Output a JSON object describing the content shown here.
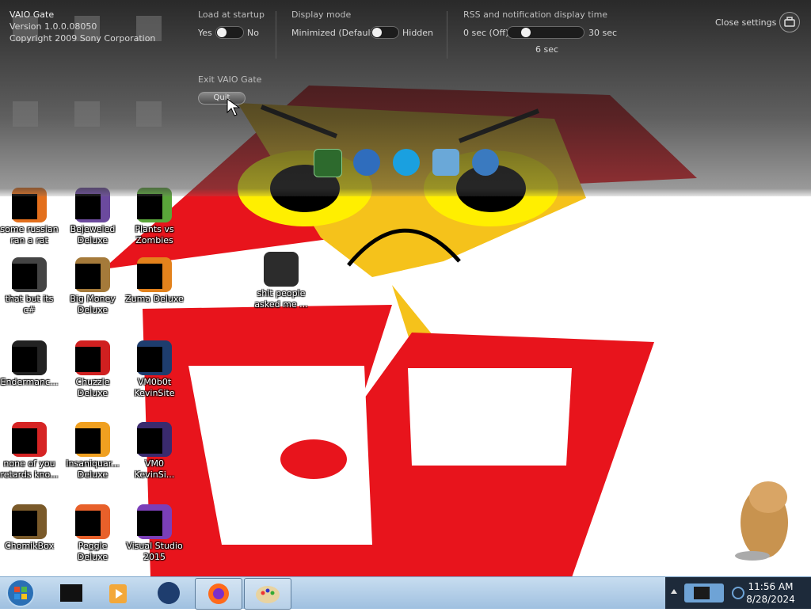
{
  "vaio": {
    "app_name": "VAIO Gate",
    "version": "Version 1.0.0.08050",
    "copyright": "Copyright 2009 Sony Corporation",
    "load_at_startup": {
      "header": "Load at startup",
      "yes": "Yes",
      "no": "No",
      "value": "Yes"
    },
    "display_mode": {
      "header": "Display mode",
      "left": "Minimized (Default)",
      "right": "Hidden",
      "value": "Minimized (Default)"
    },
    "rss_time": {
      "header": "RSS and notification display time",
      "min_label": "0 sec (Off)",
      "max_label": "30 sec",
      "value_label": "6 sec",
      "value": 6,
      "max": 30
    },
    "exit": {
      "header": "Exit VAIO Gate",
      "quit_label": "Quit"
    },
    "close_settings": "Close settings",
    "dock_icons": [
      "media-gallery-icon",
      "vaio-update-icon",
      "internet-explorer-icon",
      "mail-icon",
      "network-icon"
    ]
  },
  "desktop_icons": [
    {
      "label": "some russian\nran a rat",
      "icon": "orange-app-icon"
    },
    {
      "label": "Bejeweled\nDeluxe",
      "icon": "bejeweled-icon"
    },
    {
      "label": "Plants vs\nZombies",
      "icon": "plants-vs-zombies-icon"
    },
    {
      "label": "that but its c#",
      "icon": "stacked-windows-icon"
    },
    {
      "label": "Big Money\nDeluxe",
      "icon": "money-bag-icon"
    },
    {
      "label": "Zuma Deluxe",
      "icon": "zuma-icon"
    },
    {
      "label": "shit people\nasked me ...",
      "icon": "folder-icon"
    },
    {
      "label": "Endermanc...",
      "icon": "terminal-icon"
    },
    {
      "label": "Chuzzle\nDeluxe",
      "icon": "chuzzle-icon"
    },
    {
      "label": "VM0b0t\nKevinSite",
      "icon": "vm-icon"
    },
    {
      "label": "none of you\nretards kno...",
      "icon": "red-circle-icon"
    },
    {
      "label": "Insaniquar...\nDeluxe",
      "icon": "fish-icon"
    },
    {
      "label": "VM0\nKevinSi...",
      "icon": "vm-purple-icon"
    },
    {
      "label": "ChomikBox",
      "icon": "chomikbox-icon"
    },
    {
      "label": "Peggle Deluxe",
      "icon": "peggle-icon"
    },
    {
      "label": "Visual Studio\n2015",
      "icon": "visual-studio-icon"
    }
  ],
  "taskbar": {
    "pinned": [
      "start-orb-icon",
      "vaio-box-icon",
      "media-player-icon",
      "globe-icon",
      "firefox-icon",
      "paint-icon"
    ],
    "time": "11:56 AM",
    "date": "8/28/2024"
  }
}
